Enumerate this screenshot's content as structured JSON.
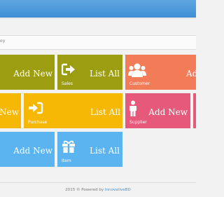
{
  "breadcrumb": "ey",
  "colors": {
    "olive": "#9c9d10",
    "coral": "#f27c57",
    "amber": "#f7b705",
    "pink": "#e6597b",
    "sky": "#5bb3ef",
    "header": "#4a98dc"
  },
  "tiles": {
    "sales_add": {
      "label": "Add New"
    },
    "sales_list": {
      "label": "List All",
      "caption": "Sales",
      "icon": "sign-out-icon"
    },
    "customer": {
      "label": "Ad",
      "caption": "Customer",
      "icon": "users-icon"
    },
    "purchase_add": {
      "label": "New"
    },
    "purchase_list": {
      "label": "List All",
      "caption": "Purchase",
      "icon": "sign-in-icon"
    },
    "supplier": {
      "label": "Add New",
      "caption": "Supplier",
      "icon": "person-icon"
    },
    "items_add": {
      "label": "Add New"
    },
    "items_list": {
      "label": "List All",
      "caption": "Item",
      "icon": "gift-icon"
    }
  },
  "footer": {
    "prefix": "2015 © Powered by",
    "brand": "InnovativeBD"
  }
}
